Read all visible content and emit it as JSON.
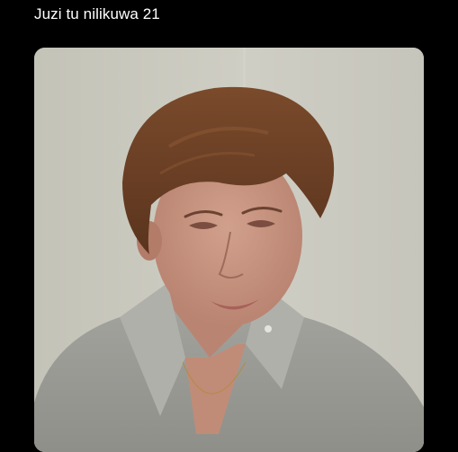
{
  "post": {
    "text": "Juzi tu nilikuwa 21"
  },
  "media": {
    "type": "photo",
    "colors": {
      "wall": "#c9c8be",
      "hair": "#6a3f24",
      "skin": "#c99683",
      "shirt": "#9a9a95"
    }
  }
}
